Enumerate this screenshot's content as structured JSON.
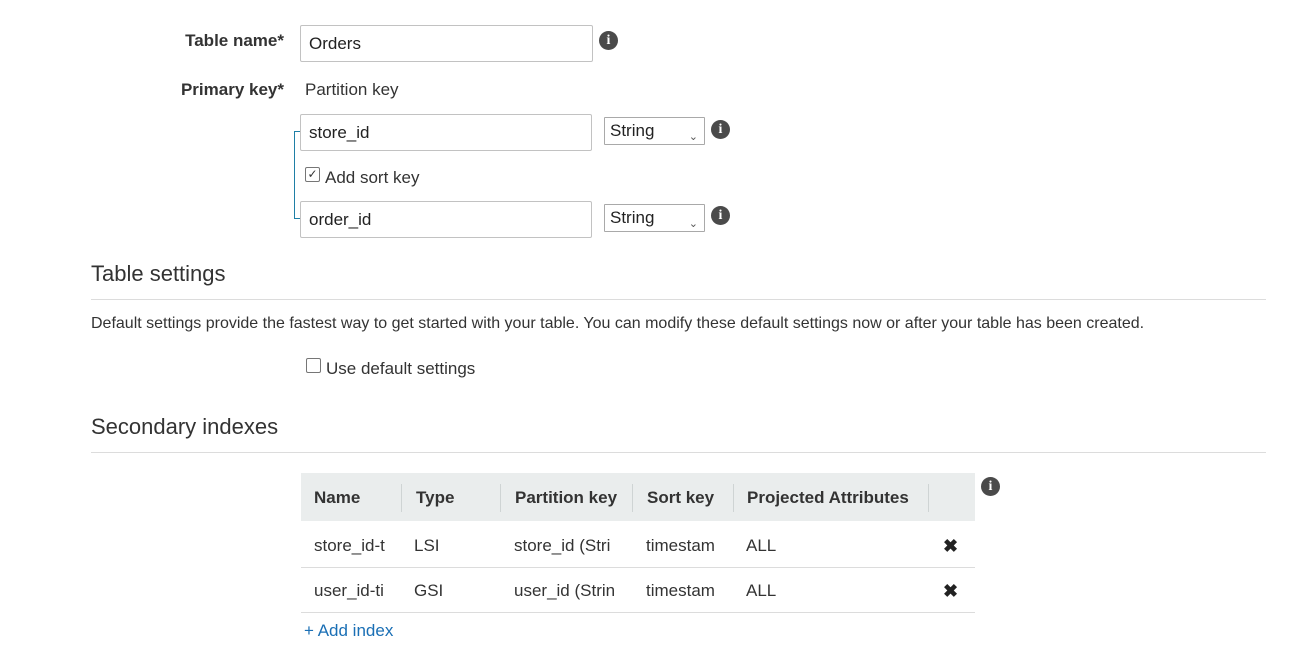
{
  "form": {
    "table_name_label": "Table name*",
    "table_name_value": "Orders",
    "primary_key_label": "Primary key*",
    "partition_key_label": "Partition key",
    "partition_key_value": "store_id",
    "partition_key_type": "String",
    "add_sort_key_label": "Add sort key",
    "add_sort_key_checked": true,
    "sort_key_value": "order_id",
    "sort_key_type": "String"
  },
  "table_settings": {
    "title": "Table settings",
    "description": "Default settings provide the fastest way to get started with your table. You can modify these default settings now or after your table has been created.",
    "use_default_label": "Use default settings",
    "use_default_checked": false
  },
  "secondary_indexes": {
    "title": "Secondary indexes",
    "columns": [
      "Name",
      "Type",
      "Partition key",
      "Sort key",
      "Projected Attributes"
    ],
    "rows": [
      {
        "name": "store_id-t",
        "type": "LSI",
        "partition_key": "store_id (Stri",
        "sort_key": "timestam",
        "projected": "ALL"
      },
      {
        "name": "user_id-ti",
        "type": "GSI",
        "partition_key": "user_id (Strin",
        "sort_key": "timestam",
        "projected": "ALL"
      }
    ],
    "add_index_label": "+ Add index"
  },
  "icons": {
    "info": "info-icon",
    "delete": "close-icon",
    "select_arrow": "chevron-down-icon"
  },
  "colors": {
    "link": "#1a6fb5",
    "table_header_bg": "#eaeded",
    "bracket": "#1f7fa6"
  }
}
